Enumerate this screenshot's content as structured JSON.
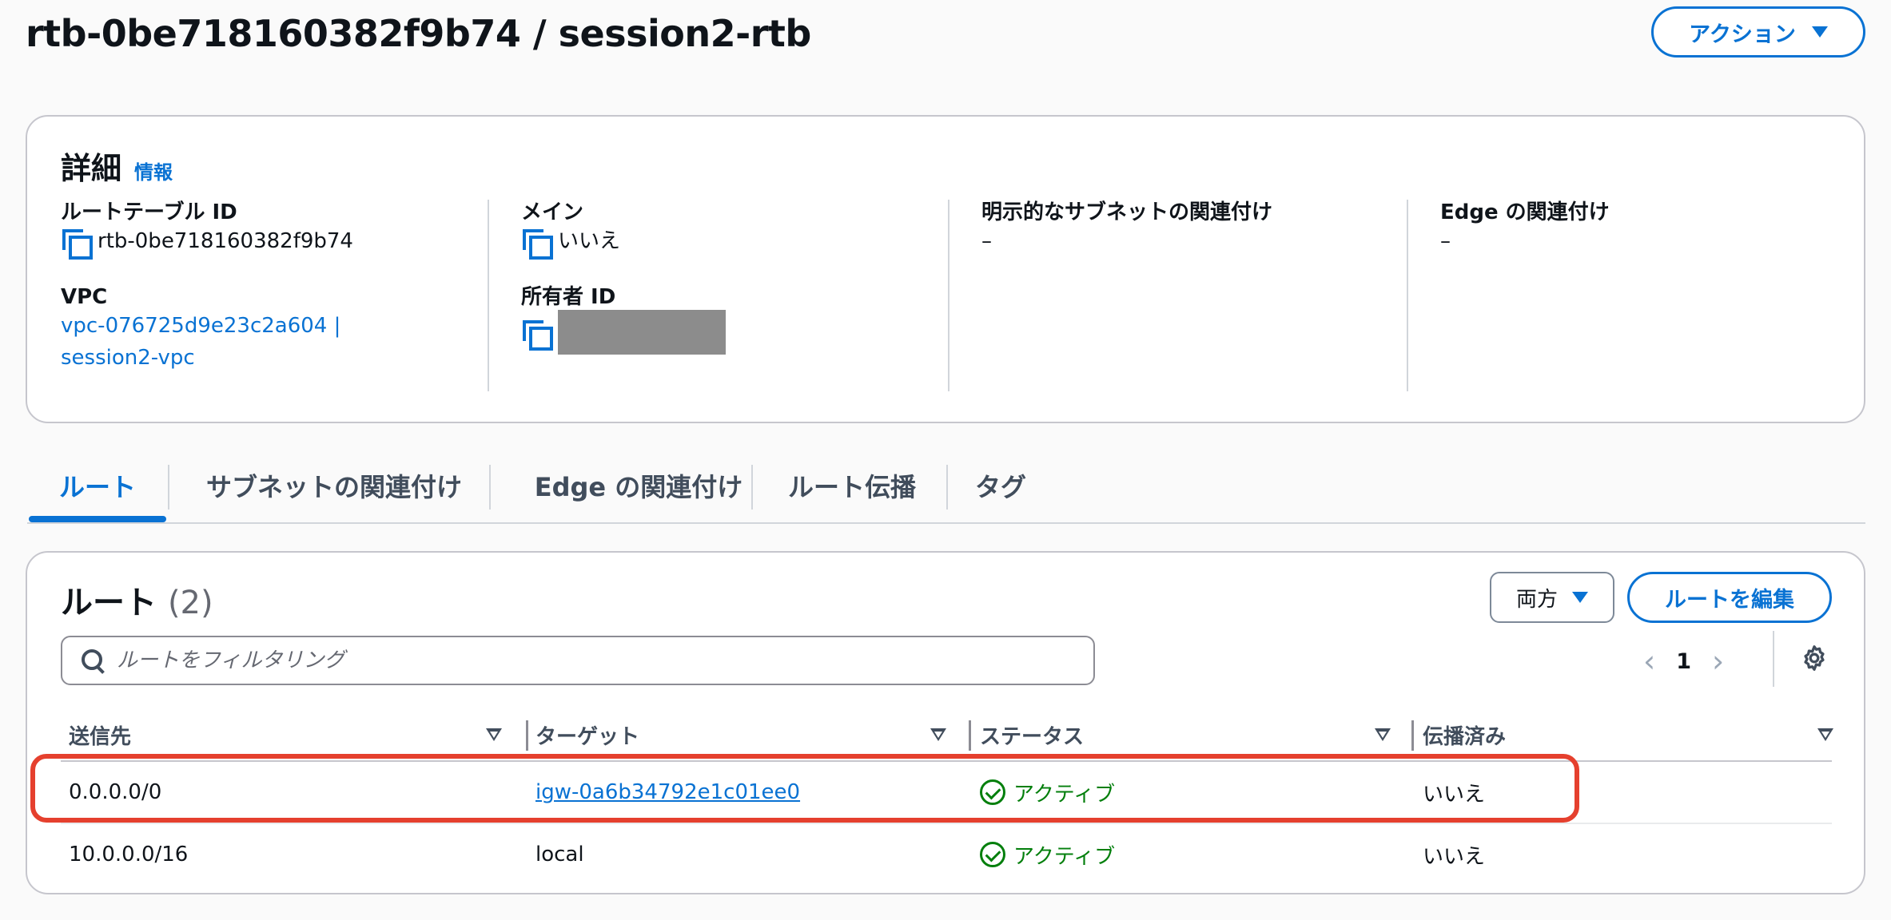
{
  "header": {
    "title": "rtb-0be718160382f9b74 / session2-rtb",
    "actions_label": "アクション"
  },
  "details": {
    "title": "詳細",
    "info_label": "情報",
    "route_table_id_label": "ルートテーブル ID",
    "route_table_id": "rtb-0be718160382f9b74",
    "vpc_label": "VPC",
    "vpc_value": "vpc-076725d9e23c2a604 | session2-vpc",
    "main_label": "メイン",
    "main_value": "いいえ",
    "owner_id_label": "所有者 ID",
    "explicit_subnet_label": "明示的なサブネットの関連付け",
    "explicit_subnet_value": "–",
    "edge_assoc_label": "Edge の関連付け",
    "edge_assoc_value": "–"
  },
  "tabs": [
    {
      "label": "ルート",
      "active": true
    },
    {
      "label": "サブネットの関連付け",
      "active": false
    },
    {
      "label": "Edge の関連付け",
      "active": false
    },
    {
      "label": "ルート伝播",
      "active": false
    },
    {
      "label": "タグ",
      "active": false
    }
  ],
  "routes": {
    "title": "ルート",
    "count": "(2)",
    "direction_label": "両方",
    "edit_label": "ルートを編集",
    "search_placeholder": "ルートをフィルタリング",
    "page": "1",
    "columns": [
      "送信先",
      "ターゲット",
      "ステータス",
      "伝播済み"
    ],
    "rows": [
      {
        "destination": "0.0.0.0/0",
        "target": "igw-0a6b34792e1c01ee0",
        "target_is_link": true,
        "status": "アクティブ",
        "propagated": "いいえ",
        "highlighted": true
      },
      {
        "destination": "10.0.0.0/16",
        "target": "local",
        "target_is_link": false,
        "status": "アクティブ",
        "propagated": "いいえ",
        "highlighted": false
      }
    ]
  },
  "colors": {
    "accent": "#0972d3",
    "success": "#037f0c",
    "highlight": "#e5402e"
  },
  "icons": [
    "chevron-down-icon",
    "copy-icon",
    "search-icon",
    "chevron-left-icon",
    "chevron-right-icon",
    "gear-icon",
    "sort-icon",
    "check-circle-icon"
  ]
}
